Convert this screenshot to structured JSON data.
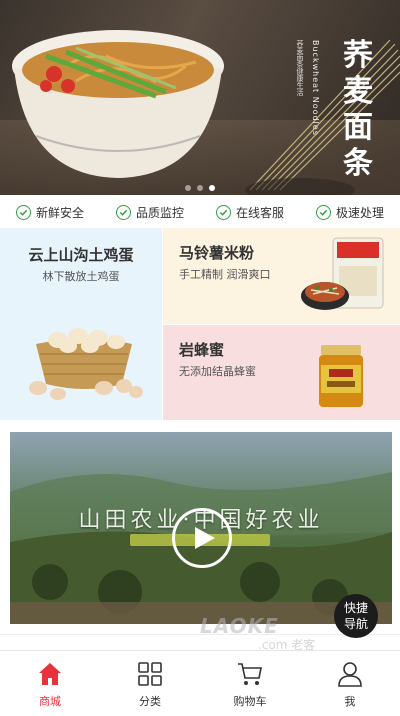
{
  "banner": {
    "title_cn": "荞麦面条",
    "title_en": "Buckwheat Noodles",
    "small_text": "荞麦面条健康生活",
    "slide_count": 3,
    "active_slide": 2
  },
  "features": [
    {
      "label": "新鲜安全",
      "icon": "check-circle-icon"
    },
    {
      "label": "品质监控",
      "icon": "check-circle-icon"
    },
    {
      "label": "在线客服",
      "icon": "check-circle-icon"
    },
    {
      "label": "极速处理",
      "icon": "check-circle-icon"
    }
  ],
  "products": {
    "eggs": {
      "title": "云上山沟土鸡蛋",
      "subtitle": "林下散放土鸡蛋"
    },
    "vermicelli": {
      "title": "马铃薯米粉",
      "subtitle": "手工精制 润滑爽口"
    },
    "honey": {
      "title": "岩蜂蜜",
      "subtitle": "无添加结晶蜂蜜"
    }
  },
  "video": {
    "caption": "山田农业·中国好农业",
    "play_icon": "play-icon"
  },
  "quick_nav": {
    "line1": "快捷",
    "line2": "导航"
  },
  "watermark": {
    "text": "LAOKE",
    "sub": ".com 老客"
  },
  "bottom_nav": [
    {
      "label": "商城",
      "icon": "home-icon",
      "active": true
    },
    {
      "label": "分类",
      "icon": "category-icon",
      "active": false
    },
    {
      "label": "购物车",
      "icon": "cart-icon",
      "active": false
    },
    {
      "label": "我",
      "icon": "user-icon",
      "active": false
    }
  ],
  "colors": {
    "accent": "#e8333b",
    "check": "#2ea043"
  }
}
